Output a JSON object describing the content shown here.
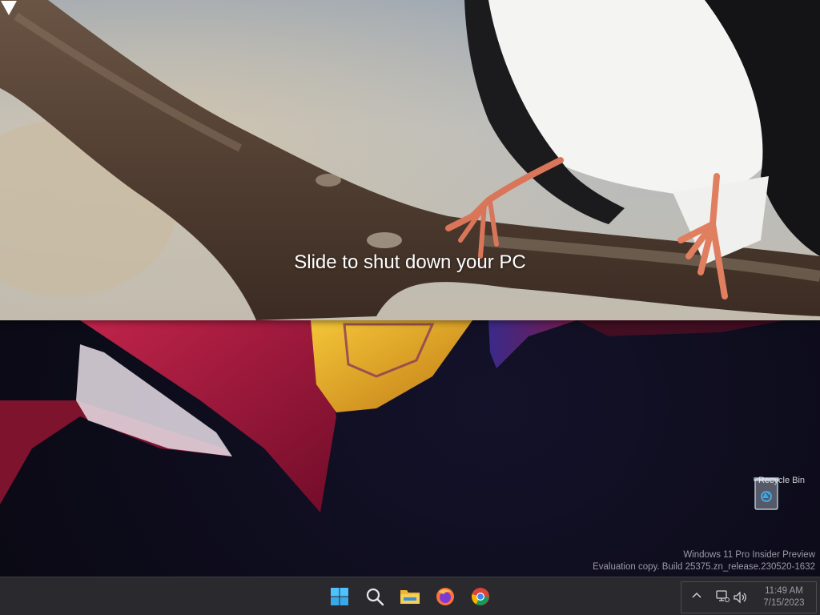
{
  "overlay": {
    "prompt": "Slide to shut down your PC",
    "arrow_icon": "down-arrow-icon"
  },
  "desktop": {
    "icons": [
      {
        "label": "Recycle Bin",
        "icon": "recycle-bin-icon"
      }
    ],
    "watermark": {
      "line1": "Windows 11 Pro Insider Preview",
      "line2": "Evaluation copy. Build 25375.zn_release.230520-1632"
    }
  },
  "taskbar": {
    "apps": [
      {
        "name": "Start",
        "icon": "windows-start-icon"
      },
      {
        "name": "Search",
        "icon": "search-icon"
      },
      {
        "name": "File Explorer",
        "icon": "file-explorer-icon"
      },
      {
        "name": "Firefox",
        "icon": "firefox-icon"
      },
      {
        "name": "Chrome",
        "icon": "chrome-icon"
      }
    ],
    "tray": {
      "icons": [
        "chevron-up-icon",
        "network-icon",
        "volume-icon"
      ],
      "time": "11:49 AM",
      "date": "7/15/2023"
    }
  },
  "colors": {
    "taskbar_bg": "#2a2a2e",
    "start_blue": "#4cc2ff",
    "overlay_text": "#ffffff"
  }
}
